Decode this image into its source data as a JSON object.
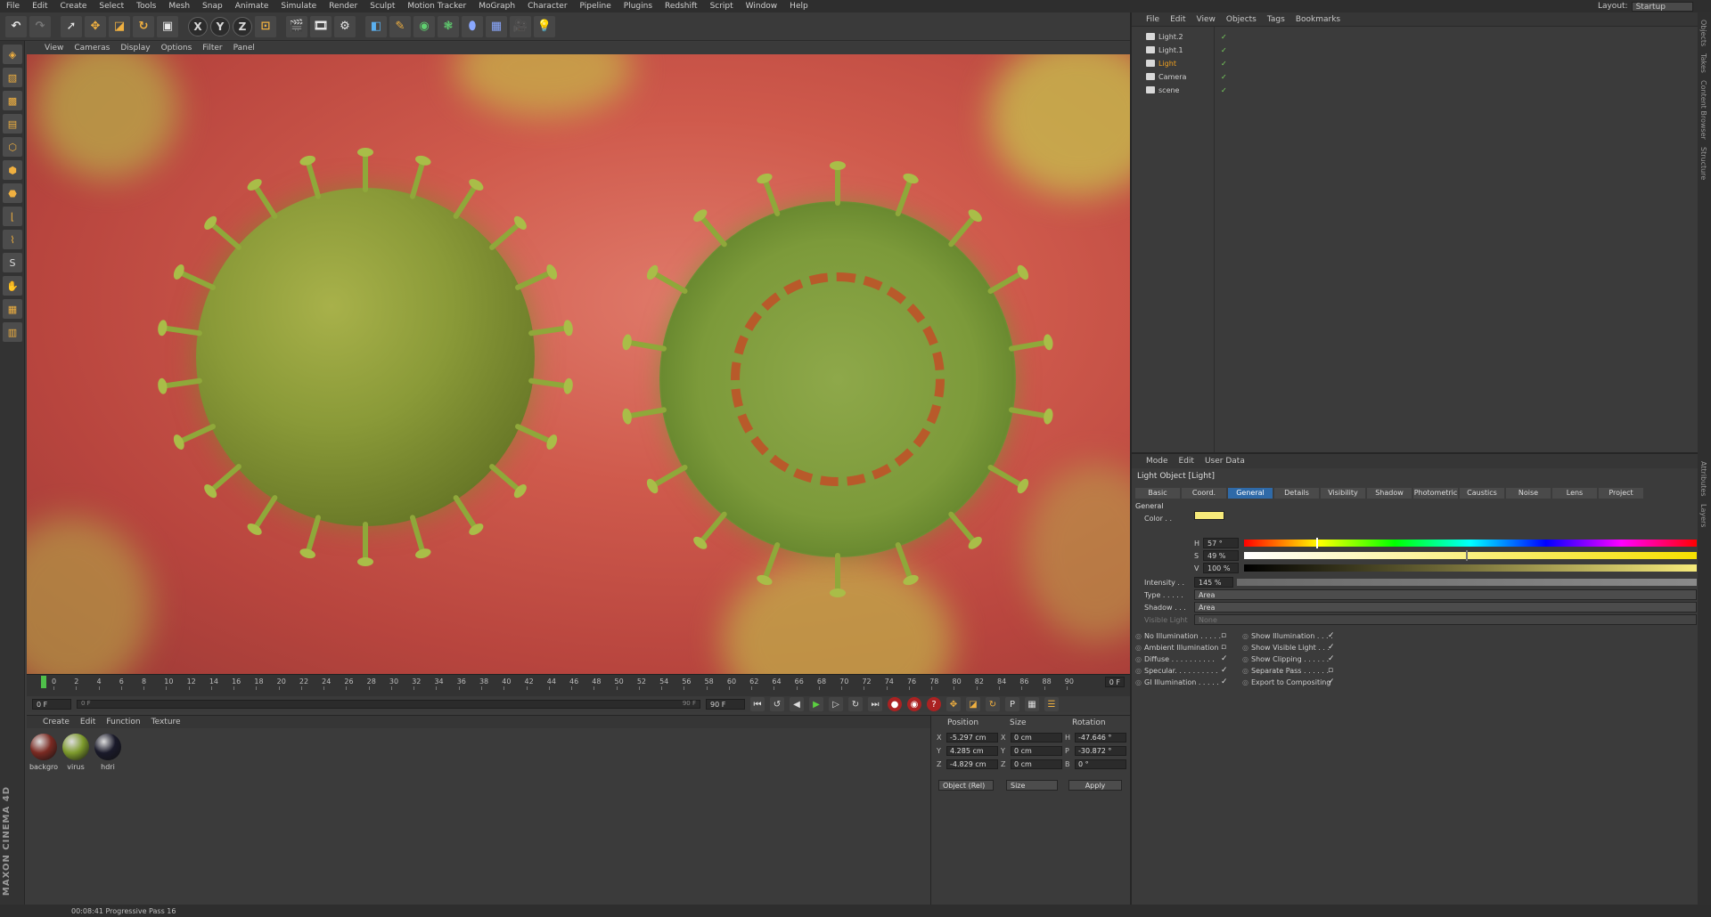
{
  "menu": [
    "File",
    "Edit",
    "Create",
    "Select",
    "Tools",
    "Mesh",
    "Snap",
    "Animate",
    "Simulate",
    "Render",
    "Sculpt",
    "Motion Tracker",
    "MoGraph",
    "Character",
    "Pipeline",
    "Plugins",
    "Redshift",
    "Script",
    "Window",
    "Help"
  ],
  "layout": {
    "label": "Layout:",
    "value": "Startup"
  },
  "toolbar": {
    "x": "X",
    "y": "Y",
    "z": "Z"
  },
  "viewport": {
    "menu": [
      "View",
      "Cameras",
      "Display",
      "Options",
      "Filter",
      "Panel"
    ]
  },
  "timeline": {
    "ticks": [
      "0",
      "2",
      "4",
      "6",
      "8",
      "10",
      "12",
      "14",
      "16",
      "18",
      "20",
      "22",
      "24",
      "26",
      "28",
      "30",
      "32",
      "34",
      "36",
      "38",
      "40",
      "42",
      "44",
      "46",
      "48",
      "50",
      "52",
      "54",
      "56",
      "58",
      "60",
      "62",
      "64",
      "66",
      "68",
      "70",
      "72",
      "74",
      "76",
      "78",
      "80",
      "82",
      "84",
      "86",
      "88",
      "90"
    ],
    "end_label": "0 F",
    "start_field": "0 F",
    "range_start": "0 F",
    "range_end": "90 F",
    "end_field": "90 F"
  },
  "materials": {
    "menu": [
      "Create",
      "Edit",
      "Function",
      "Texture"
    ],
    "items": [
      {
        "label": "backgro",
        "color": "#7a2a22"
      },
      {
        "label": "virus",
        "color": "#7d9a2c"
      },
      {
        "label": "hdri",
        "color": "#1a1a2a"
      }
    ]
  },
  "coords": {
    "headers": {
      "position": "Position",
      "size": "Size",
      "rotation": "Rotation"
    },
    "rows": [
      {
        "axis": "X",
        "pos": "-5.297 cm",
        "saxis": "X",
        "size": "0 cm",
        "raxis": "H",
        "rot": "-47.646 °"
      },
      {
        "axis": "Y",
        "pos": "4.285 cm",
        "saxis": "Y",
        "size": "0 cm",
        "raxis": "P",
        "rot": "-30.872 °"
      },
      {
        "axis": "Z",
        "pos": "-4.829 cm",
        "saxis": "Z",
        "size": "0 cm",
        "raxis": "B",
        "rot": "0 °"
      }
    ],
    "mode_select": "Object (Rel)",
    "size_select": "Size",
    "apply": "Apply"
  },
  "objects": {
    "menu": [
      "File",
      "Edit",
      "View",
      "Objects",
      "Tags",
      "Bookmarks"
    ],
    "items": [
      {
        "name": "Light.2",
        "active": false
      },
      {
        "name": "Light.1",
        "active": false
      },
      {
        "name": "Light",
        "active": true
      },
      {
        "name": "Camera",
        "active": false
      },
      {
        "name": "scene",
        "active": false
      }
    ]
  },
  "attributes": {
    "menu": [
      "Mode",
      "Edit",
      "User Data"
    ],
    "title": "Light Object [Light]",
    "tabs": [
      "Basic",
      "Coord.",
      "General",
      "Details",
      "Visibility",
      "Shadow",
      "Photometric",
      "Caustics",
      "Noise",
      "Lens",
      "Project"
    ],
    "active_tab": "General",
    "section": "General",
    "color_label": "Color . .",
    "color_value": "#f6ea7a",
    "h": {
      "label": "H",
      "value": "57 °",
      "fraction": 0.16
    },
    "s": {
      "label": "S",
      "value": "49 %",
      "fraction": 0.49
    },
    "v": {
      "label": "V",
      "value": "100 %",
      "fraction": 1.0
    },
    "intensity": {
      "label": "Intensity . .",
      "value": "145 %",
      "fraction": 1.0
    },
    "type": {
      "label": "Type . . . . .",
      "value": "Area"
    },
    "shadow": {
      "label": "Shadow . . .",
      "value": "Area"
    },
    "visible_light": {
      "label": "Visible Light",
      "value": "None"
    },
    "left_checks": [
      {
        "label": "No Illumination . . . . .",
        "checked": false
      },
      {
        "label": "Ambient Illumination",
        "checked": false
      },
      {
        "label": "Diffuse . . . . . . . . . .",
        "checked": true
      },
      {
        "label": "Specular. . . . . . . . . .",
        "checked": true
      },
      {
        "label": "GI Illumination . . . . .",
        "checked": true
      }
    ],
    "right_checks": [
      {
        "label": "Show Illumination . . . .",
        "checked": true
      },
      {
        "label": "Show Visible Light . . .",
        "checked": true
      },
      {
        "label": "Show Clipping . . . . . .",
        "checked": true
      },
      {
        "label": "Separate Pass . . . . . .",
        "checked": false
      },
      {
        "label": "Export to Compositing",
        "checked": true
      }
    ]
  },
  "status": {
    "text": "00:08:41 Progressive Pass 16"
  },
  "brand": {
    "text": "MAXON CINEMA 4D"
  },
  "side_tabs": [
    "Objects",
    "Takes",
    "Content Browser",
    "Structure"
  ],
  "side_tabs_lower": [
    "Attributes",
    "Layers"
  ]
}
